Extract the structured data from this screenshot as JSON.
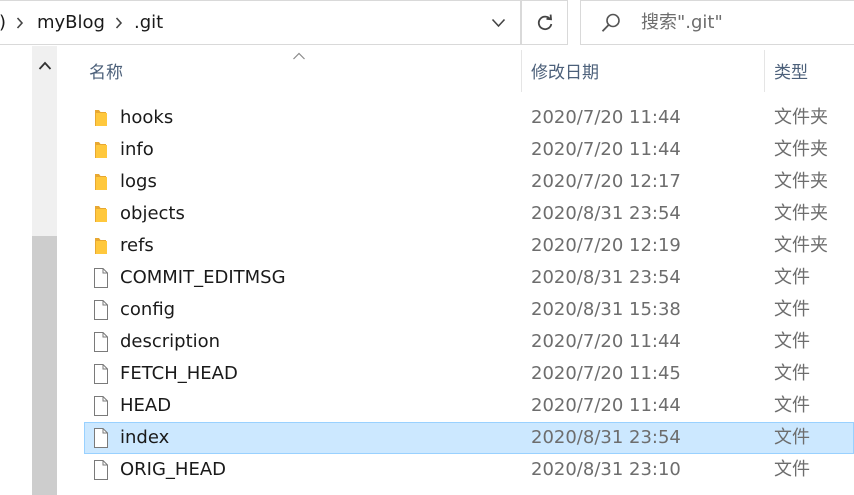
{
  "address_bar": {
    "partial_segment": ")",
    "segments": [
      "myBlog",
      ".git"
    ]
  },
  "search": {
    "placeholder": "搜索\".git\""
  },
  "columns": {
    "name": "名称",
    "date": "修改日期",
    "type": "类型"
  },
  "files": [
    {
      "name": "hooks",
      "date": "2020/7/20 11:44",
      "type": "文件夹",
      "kind": "folder-icon"
    },
    {
      "name": "info",
      "date": "2020/7/20 11:44",
      "type": "文件夹",
      "kind": "folder-icon"
    },
    {
      "name": "logs",
      "date": "2020/7/20 12:17",
      "type": "文件夹",
      "kind": "folder-icon"
    },
    {
      "name": "objects",
      "date": "2020/8/31 23:54",
      "type": "文件夹",
      "kind": "folder-icon"
    },
    {
      "name": "refs",
      "date": "2020/7/20 12:19",
      "type": "文件夹",
      "kind": "folder-icon"
    },
    {
      "name": "COMMIT_EDITMSG",
      "date": "2020/8/31 23:54",
      "type": "文件",
      "kind": "file-icon"
    },
    {
      "name": "config",
      "date": "2020/8/31 15:38",
      "type": "文件",
      "kind": "file-icon"
    },
    {
      "name": "description",
      "date": "2020/7/20 11:44",
      "type": "文件",
      "kind": "file-icon"
    },
    {
      "name": "FETCH_HEAD",
      "date": "2020/7/20 11:45",
      "type": "文件",
      "kind": "file-icon"
    },
    {
      "name": "HEAD",
      "date": "2020/7/20 11:44",
      "type": "文件",
      "kind": "file-icon"
    },
    {
      "name": "index",
      "date": "2020/8/31 23:54",
      "type": "文件",
      "kind": "file-icon",
      "selected": true
    },
    {
      "name": "ORIG_HEAD",
      "date": "2020/8/31 23:10",
      "type": "文件",
      "kind": "file-icon"
    }
  ],
  "colors": {
    "selection_bg": "#cce8ff",
    "selection_border": "#99d1ff",
    "folder": "#ffc83d",
    "header_text": "#4c607a"
  }
}
